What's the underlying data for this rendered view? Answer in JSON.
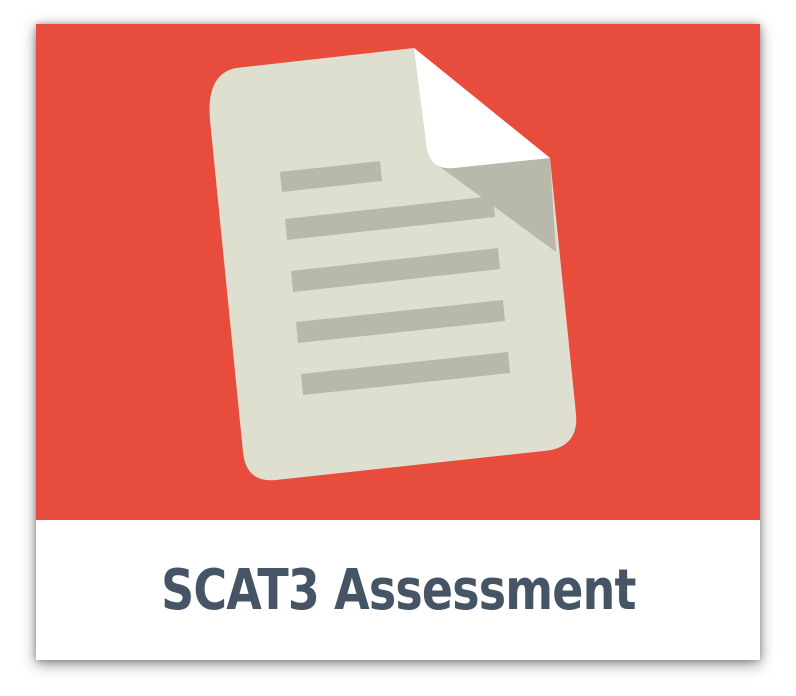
{
  "tile": {
    "caption": "SCAT3 Assessment",
    "icon": "document-icon"
  },
  "colors": {
    "banner_background": "#e84c3d",
    "caption_background": "#ffffff",
    "caption_text": "#465565",
    "paper": "#dfdfd0",
    "paper_lines": "#b9b9ab",
    "page_fold": "#ffffff"
  }
}
